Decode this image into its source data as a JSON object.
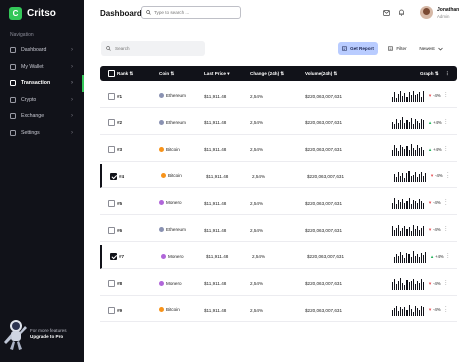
{
  "brand": {
    "name": "Critso",
    "logo_letter": "C",
    "accent": "#34c759"
  },
  "sidebar": {
    "heading": "Navigation",
    "items": [
      {
        "label": "Dashboard",
        "icon": "grid-icon",
        "active": false
      },
      {
        "label": "My Wallet",
        "icon": "wallet-icon",
        "active": false
      },
      {
        "label": "Transaction",
        "icon": "transaction-icon",
        "active": true
      },
      {
        "label": "Crypto",
        "icon": "crypto-icon",
        "active": false
      },
      {
        "label": "Exchange",
        "icon": "exchange-icon",
        "active": false
      },
      {
        "label": "Settings",
        "icon": "settings-icon",
        "active": false
      }
    ],
    "promo": {
      "line1": "For more features",
      "line2": "Upgrade to Pro"
    }
  },
  "header": {
    "title": "Dashboard",
    "search_placeholder": "Type to search ...",
    "user": {
      "name": "Jonathan",
      "role": "Admin"
    }
  },
  "toolbar": {
    "search_placeholder": "Search",
    "report_label": "Get Report",
    "filter_label": "Filter",
    "sort_label": "Newest"
  },
  "table": {
    "columns": {
      "rank": "Rank",
      "coin": "Coin",
      "last_price": "Last Price",
      "change": "Change (24h)",
      "volume": "Volume(24h)",
      "graph": "Graph"
    },
    "rows": [
      {
        "rank": "#1",
        "coin": "Ethereum",
        "coin_color": "#8a92b2",
        "price": "$11,911.48",
        "change": "2,54%",
        "volume": "$220,063,007,631",
        "delta": "4%",
        "up": false,
        "checked": false,
        "bars": [
          0.45,
          0.8,
          0.35,
          0.7,
          0.9,
          0.5,
          0.75,
          0.4,
          0.85,
          0.6,
          0.95,
          0.55,
          0.7,
          0.85,
          0.45,
          0.9
        ]
      },
      {
        "rank": "#2",
        "coin": "Ethereum",
        "coin_color": "#8a92b2",
        "price": "$11,911.48",
        "change": "2,54%",
        "volume": "$220,063,007,631",
        "delta": "4%",
        "up": true,
        "checked": false,
        "bars": [
          0.6,
          0.4,
          0.85,
          0.5,
          0.75,
          0.95,
          0.45,
          0.7,
          0.55,
          0.9,
          0.4,
          0.8,
          0.65,
          0.5,
          0.85,
          0.7
        ]
      },
      {
        "rank": "#3",
        "coin": "Bitcoin",
        "coin_color": "#f7931a",
        "price": "$11,911.48",
        "change": "2,54%",
        "volume": "$220,063,007,631",
        "delta": "4%",
        "up": true,
        "checked": false,
        "bars": [
          0.5,
          0.85,
          0.6,
          0.4,
          0.9,
          0.7,
          0.55,
          0.8,
          0.45,
          0.95,
          0.65,
          0.5,
          0.85,
          0.6,
          0.75,
          0.45
        ]
      },
      {
        "rank": "#4",
        "coin": "Bitcoin",
        "coin_color": "#f7931a",
        "price": "$11,911.48",
        "change": "2,54%",
        "volume": "$220,063,007,631",
        "delta": "4%",
        "up": false,
        "checked": true,
        "bars": [
          0.7,
          0.45,
          0.9,
          0.55,
          0.8,
          0.4,
          0.75,
          0.95,
          0.5,
          0.65,
          0.85,
          0.45,
          0.7,
          0.9,
          0.55,
          0.8
        ]
      },
      {
        "rank": "#5",
        "coin": "Monero",
        "coin_color": "#b066d9",
        "price": "$11,911.48",
        "change": "2,54%",
        "volume": "$220,063,007,631",
        "delta": "4%",
        "up": false,
        "checked": false,
        "bars": [
          0.55,
          0.9,
          0.45,
          0.75,
          0.6,
          0.85,
          0.5,
          0.7,
          0.95,
          0.4,
          0.8,
          0.65,
          0.55,
          0.85,
          0.7,
          0.5
        ]
      },
      {
        "rank": "#6",
        "coin": "Ethereum",
        "coin_color": "#8a92b2",
        "price": "$11,911.48",
        "change": "2,54%",
        "volume": "$220,063,007,631",
        "delta": "4%",
        "up": false,
        "checked": false,
        "bars": [
          0.8,
          0.5,
          0.7,
          0.95,
          0.45,
          0.65,
          0.85,
          0.55,
          0.75,
          0.4,
          0.9,
          0.6,
          0.8,
          0.5,
          0.7,
          0.85
        ]
      },
      {
        "rank": "#7",
        "coin": "Monero",
        "coin_color": "#b066d9",
        "price": "$11,911.48",
        "change": "2,54%",
        "volume": "$220,063,007,631",
        "delta": "4%",
        "up": true,
        "checked": true,
        "bars": [
          0.45,
          0.75,
          0.55,
          0.9,
          0.65,
          0.4,
          0.85,
          0.7,
          0.5,
          0.95,
          0.6,
          0.75,
          0.45,
          0.8,
          0.65,
          0.9
        ]
      },
      {
        "rank": "#8",
        "coin": "Monero",
        "coin_color": "#b066d9",
        "price": "$11,911.48",
        "change": "2,54%",
        "volume": "$220,063,007,631",
        "delta": "4%",
        "up": false,
        "checked": false,
        "bars": [
          0.65,
          0.85,
          0.5,
          0.7,
          0.95,
          0.55,
          0.4,
          0.8,
          0.6,
          0.75,
          0.9,
          0.45,
          0.7,
          0.55,
          0.85,
          0.6
        ]
      },
      {
        "rank": "#9",
        "coin": "Bitcoin",
        "coin_color": "#f7931a",
        "price": "$11,911.48",
        "change": "2,54%",
        "volume": "$220,063,007,631",
        "delta": "4%",
        "up": false,
        "checked": false,
        "bars": [
          0.5,
          0.7,
          0.9,
          0.45,
          0.8,
          0.6,
          0.75,
          0.55,
          0.95,
          0.65,
          0.4,
          0.85,
          0.7,
          0.5,
          0.9,
          0.75
        ]
      }
    ]
  },
  "colors": {
    "up": "#21b35a",
    "down": "#e5484d",
    "dark": "#111219",
    "report_button": "#b9ccff"
  }
}
